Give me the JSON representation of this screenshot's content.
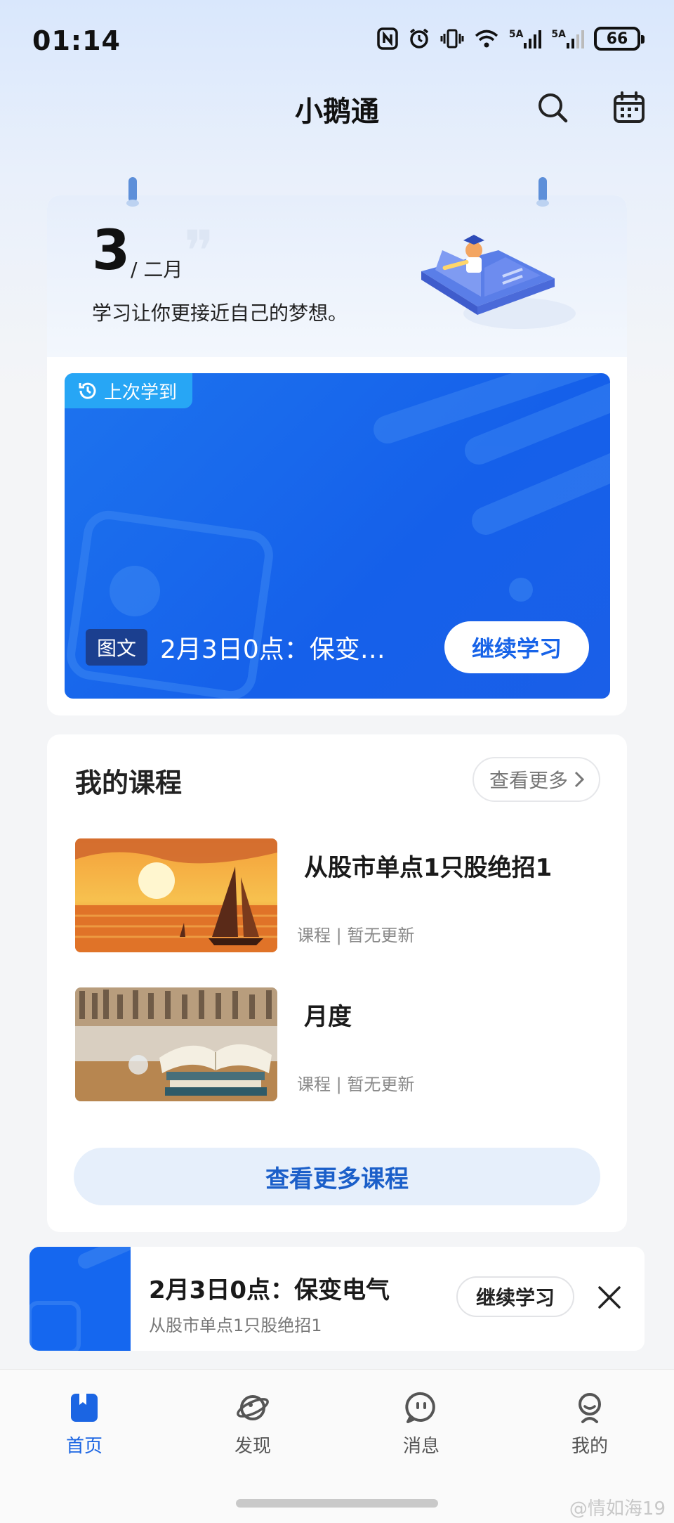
{
  "status_bar": {
    "time": "01:14",
    "battery": "66",
    "signal_labels": [
      "5A",
      "5A"
    ]
  },
  "header": {
    "title": "小鹅通",
    "icons": [
      "search-icon",
      "calendar-icon"
    ]
  },
  "date_card": {
    "day": "3",
    "month": "/ 二月",
    "motto": "学习让你更接近自己的梦想。"
  },
  "last_learned": {
    "tag": "上次学到",
    "type_badge": "图文",
    "lesson_title": "2月3日0点：保变…",
    "continue_label": "继续学习",
    "colors": {
      "banner": "#1763e8",
      "tag": "#27a6f5"
    }
  },
  "my_courses": {
    "title": "我的课程",
    "more_label": "查看更多",
    "items": [
      {
        "name": "从股市单点1只股绝招1",
        "meta": "课程 | 暂无更新",
        "thumb": "sunset-sailboat-painting"
      },
      {
        "name": "月度",
        "meta": "课程 | 暂无更新",
        "thumb": "open-book-on-stack"
      }
    ],
    "view_all_label": "查看更多课程"
  },
  "mini_player": {
    "title": "2月3日0点：保变电气",
    "subtitle": "从股市单点1只股绝招1",
    "button_label": "继续学习"
  },
  "bottom_nav": {
    "items": [
      {
        "label": "首页",
        "icon": "home-icon",
        "active": true
      },
      {
        "label": "发现",
        "icon": "planet-icon",
        "active": false
      },
      {
        "label": "消息",
        "icon": "message-icon",
        "active": false
      },
      {
        "label": "我的",
        "icon": "profile-icon",
        "active": false
      }
    ],
    "accent": "#1b65e3"
  },
  "watermark": "@情如海19"
}
